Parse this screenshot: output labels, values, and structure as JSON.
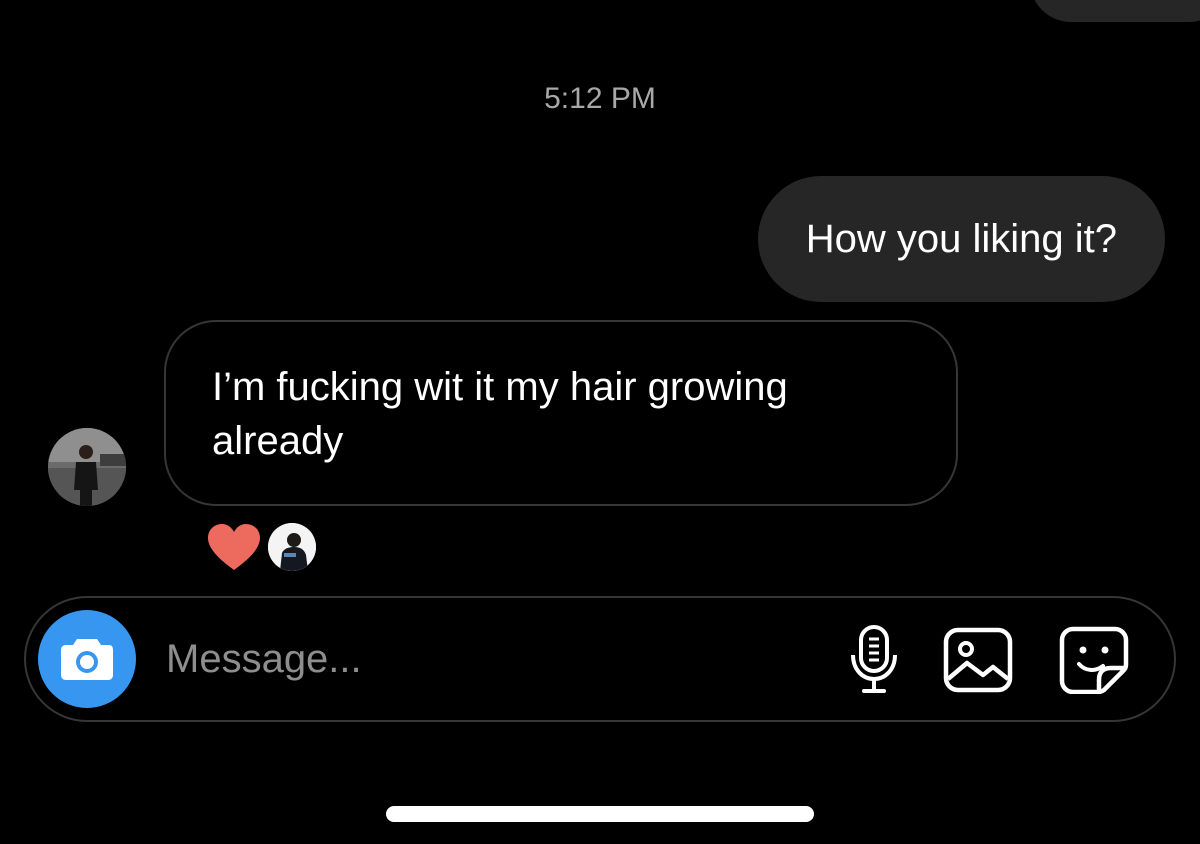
{
  "timestamp": "5:12 PM",
  "messages": {
    "sent": {
      "text": "How you liking it?"
    },
    "received": {
      "text": "I’m fucking wit it my hair growing already"
    }
  },
  "reactions": {
    "emoji": "heart",
    "count": 1
  },
  "composer": {
    "placeholder": "Message...",
    "value": ""
  },
  "colors": {
    "background": "#000000",
    "sent_bubble": "#262626",
    "camera_button": "#3797f0",
    "heart": "#ed6a5e",
    "timestamp": "#a8a8a8",
    "placeholder": "#8e8e8e"
  },
  "icons": {
    "camera": "camera-icon",
    "mic": "microphone-icon",
    "gallery": "image-icon",
    "sticker": "sticker-icon",
    "reaction": "heart-icon"
  }
}
